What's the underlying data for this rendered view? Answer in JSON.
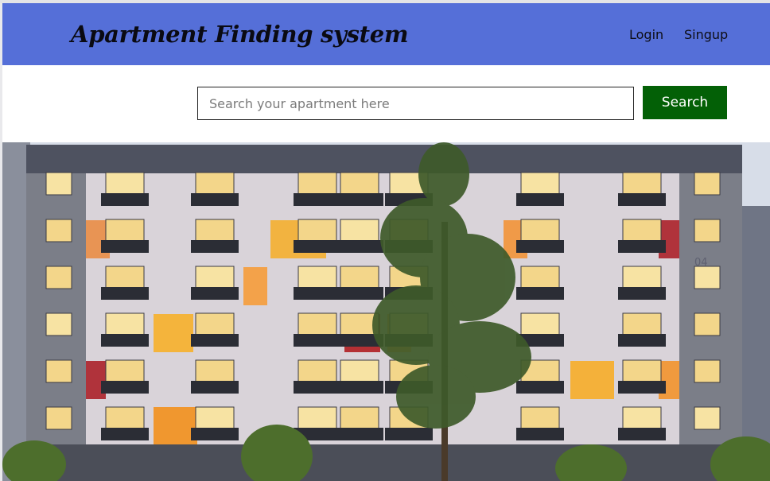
{
  "header": {
    "brand_title": "Apartment Finding system",
    "nav": {
      "login_label": "Login",
      "signup_label": "Singup"
    }
  },
  "search": {
    "placeholder": "Search your apartment here",
    "button_label": "Search"
  },
  "hero": {
    "building_number": "04"
  },
  "colors": {
    "navbar_bg": "#556fd8",
    "search_button_bg": "#036006"
  }
}
